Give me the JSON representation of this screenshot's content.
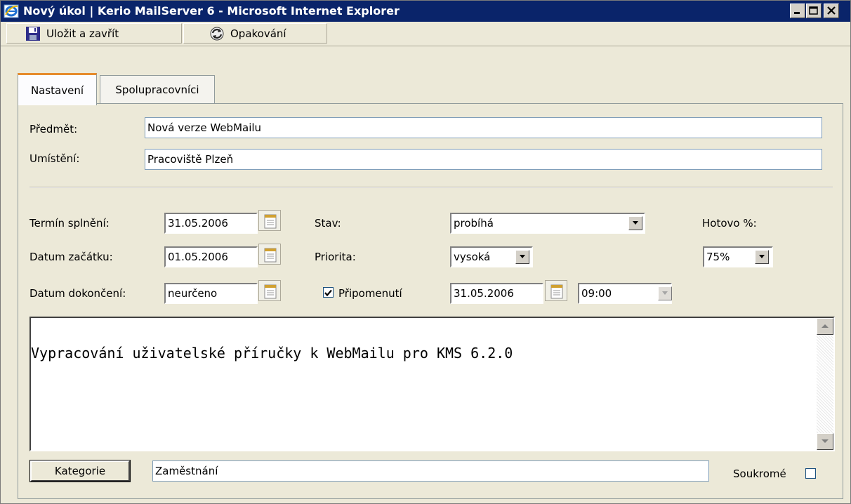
{
  "window": {
    "title": "Nový úkol | Kerio MailServer 6 - Microsoft Internet Explorer",
    "controls": [
      "minimize",
      "maximize",
      "close"
    ]
  },
  "toolbar": {
    "save_close_label": "Uložit a zavřít",
    "repeat_label": "Opakování"
  },
  "tabs": [
    {
      "label": "Nastavení",
      "active": true
    },
    {
      "label": "Spolupracovníci",
      "active": false
    }
  ],
  "form": {
    "subject_label": "Předmět:",
    "subject_value": "Nová verze WebMailu",
    "location_label": "Umístění:",
    "location_value": "Pracoviště Plzeň",
    "due_label": "Termín splnění:",
    "due_value": "31.05.2006",
    "start_label": "Datum začátku:",
    "start_value": "01.05.2006",
    "completed_label": "Datum dokončení:",
    "completed_value": "neurčeno",
    "status_label": "Stav:",
    "status_value": "probíhá",
    "priority_label": "Priorita:",
    "priority_value": "vysoká",
    "reminder_label": "Připomenutí",
    "reminder_checked": true,
    "reminder_date": "31.05.2006",
    "reminder_time": "09:00",
    "done_label": "Hotovo %:",
    "done_value": "75%",
    "description": "Vypracování uživatelské příručky k WebMailu pro KMS 6.2.0",
    "category_button": "Kategorie",
    "category_value": "Zaměstnání",
    "private_label": "Soukromé",
    "private_checked": false
  },
  "colors": {
    "titlebar": "#0a246a",
    "window_bg": "#ece9d8",
    "active_tab_accent": "#e68b2c"
  }
}
